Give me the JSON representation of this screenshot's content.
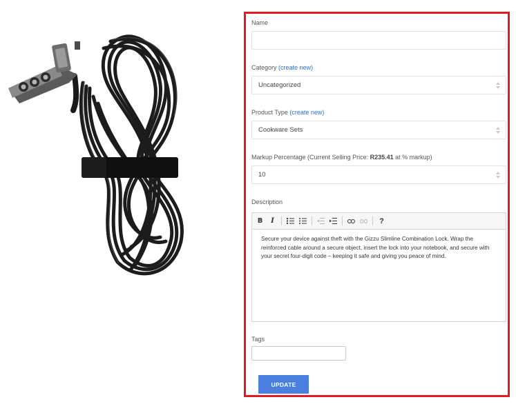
{
  "product": {
    "image_name": "combination-lock-cable"
  },
  "form": {
    "name": {
      "label": "Name",
      "value": ""
    },
    "category": {
      "label": "Category",
      "create_link": "(create new)",
      "selected": "Uncategorized"
    },
    "product_type": {
      "label": "Product Type",
      "create_link": "(create new)",
      "selected": "Cookware Sets"
    },
    "markup": {
      "label_prefix": "Markup Percentage (Current Selling Price: ",
      "price": "R235.41",
      "label_suffix": " at % markup)",
      "value": "10"
    },
    "description": {
      "label": "Description",
      "toolbar": {
        "bold": "B",
        "italic": "I",
        "help": "?"
      },
      "text": "Secure your device against theft with the Gizzu Slimline Combination Lock. Wrap the reinforced cable around a secure object, insert the lock into your notebook, and secure with your secret four-digit code – keeping it safe and giving you peace of mind."
    },
    "tags": {
      "label": "Tags",
      "value": ""
    },
    "update_label": "UPDATE"
  },
  "colors": {
    "highlight_border": "#e01b24",
    "link": "#2a6fdb",
    "button": "#4a7fe0"
  }
}
